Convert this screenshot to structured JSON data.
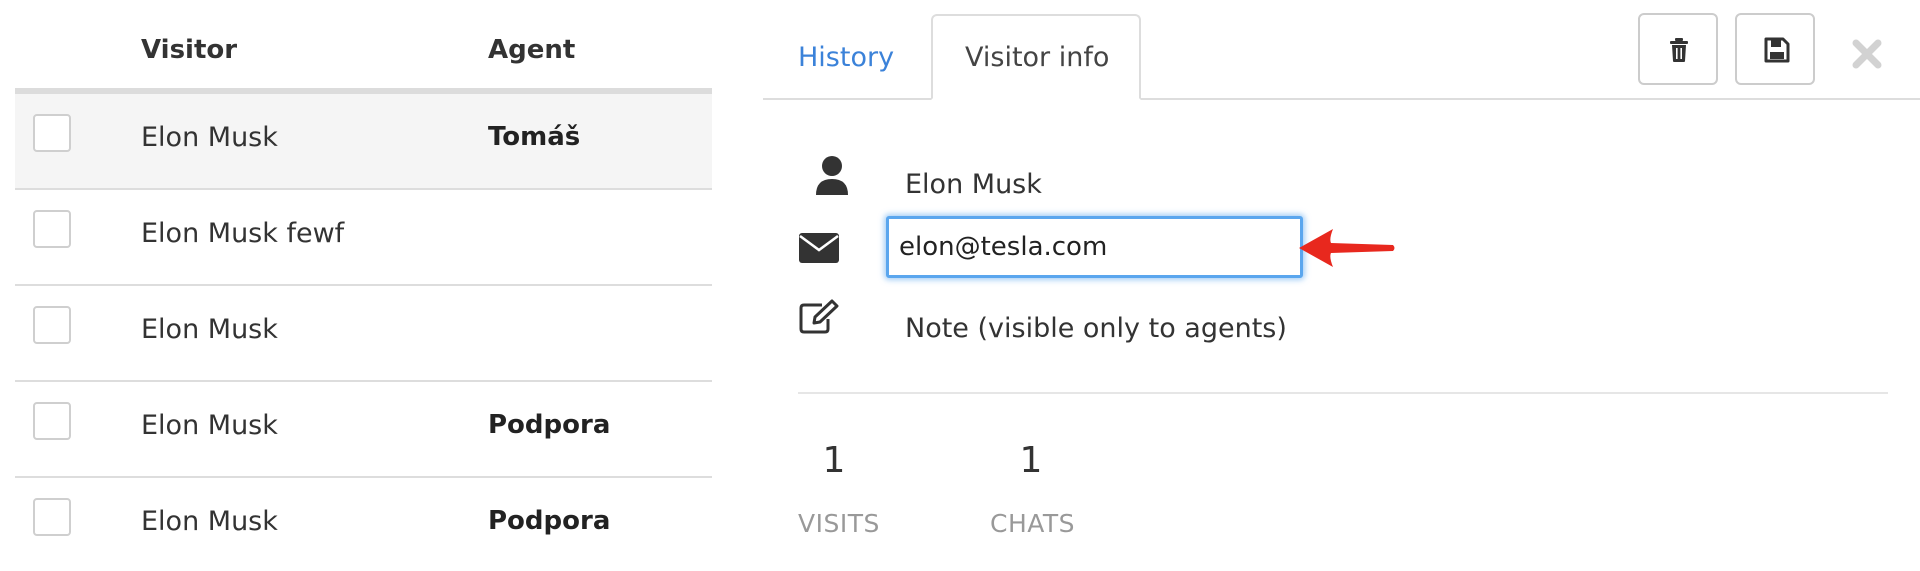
{
  "table": {
    "headers": {
      "visitor": "Visitor",
      "agent": "Agent"
    },
    "rows": [
      {
        "visitor": "Elon Musk",
        "agent": "Tomáš"
      },
      {
        "visitor": "Elon Musk fewf",
        "agent": ""
      },
      {
        "visitor": "Elon Musk",
        "agent": ""
      },
      {
        "visitor": "Elon Musk",
        "agent": "Podpora"
      },
      {
        "visitor": "Elon Musk",
        "agent": "Podpora"
      }
    ]
  },
  "panel": {
    "tabs": {
      "history": "History",
      "visitor_info": "Visitor info"
    },
    "active_tab": "Visitor info",
    "toolbar": {
      "delete_icon": "trash-icon",
      "save_icon": "floppy-disk-icon",
      "close_icon": "close-icon"
    },
    "visitor_name": "Elon Musk",
    "email_value": "elon@tesla.com",
    "note_placeholder": "Note (visible only to agents)",
    "stats": {
      "visits": {
        "value": "1",
        "label": "VISITS"
      },
      "chats": {
        "value": "1",
        "label": "CHATS"
      }
    }
  },
  "colors": {
    "tab_link": "#3b82d9",
    "focus_border": "#5aa6ee",
    "annotation_arrow": "#e8281e",
    "muted_label": "#999999"
  }
}
